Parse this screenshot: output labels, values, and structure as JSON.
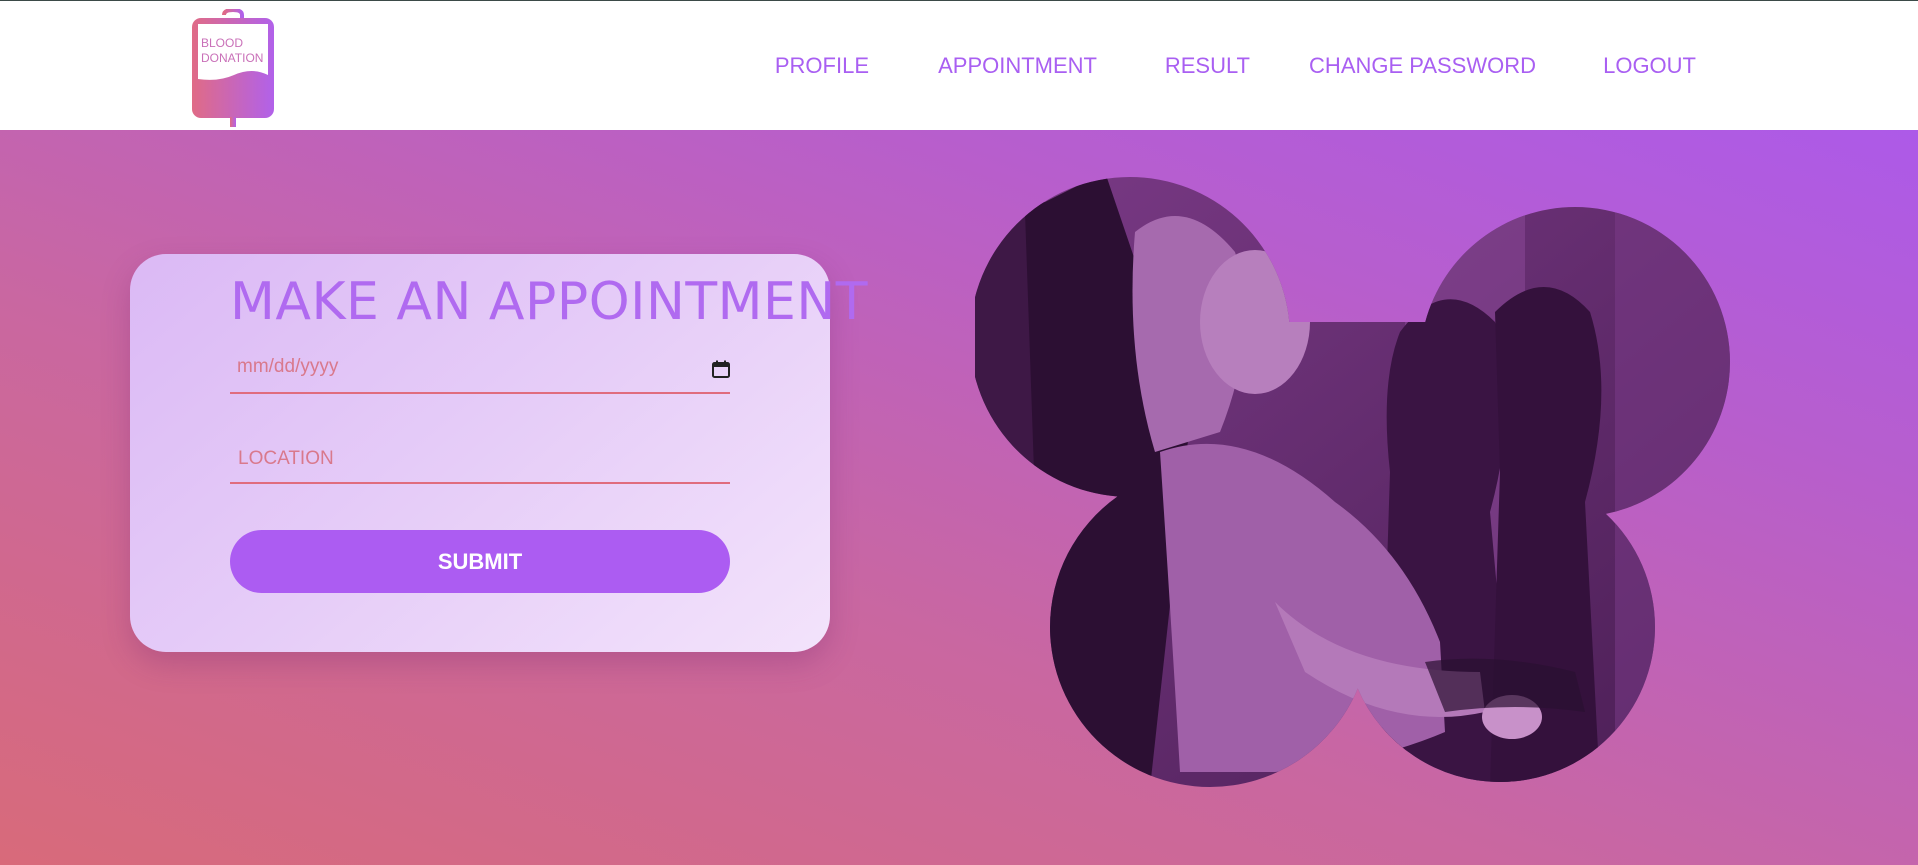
{
  "logo": {
    "line1": "BLOOD",
    "line2": "DONATION"
  },
  "nav": {
    "items": [
      {
        "label": "PROFILE"
      },
      {
        "label": "APPOINTMENT"
      },
      {
        "label": "RESULT"
      },
      {
        "label": "CHANGE PASSWORD"
      },
      {
        "label": "LOGOUT"
      }
    ]
  },
  "form": {
    "title": "MAKE AN APPOINTMENT",
    "date_placeholder": "mm/dd/yyyy",
    "location_placeholder": "LOCATION",
    "submit_label": "SUBMIT"
  },
  "colors": {
    "accent": "#ac5cf2",
    "nav_text": "#a95ff2",
    "field_underline": "#e06c7e",
    "gradient_start": "#d86a7a",
    "gradient_end": "#ad5ae8"
  }
}
